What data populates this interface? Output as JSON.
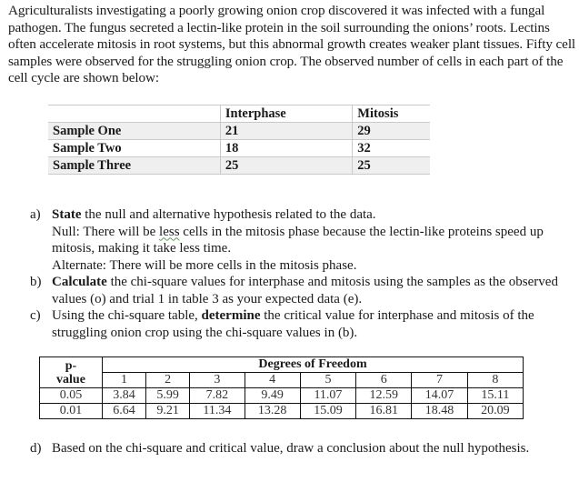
{
  "intro": {
    "paragraph": "Agriculturalists investigating a poorly growing onion crop discovered it was infected with a fungal pathogen. The fungus secreted a lectin-like protein in the soil surrounding the onions’ roots. Lectins often accelerate mitosis in root systems, but this abnormal growth creates weaker plant tissues. Fifty cell samples were observed for the struggling onion crop. The observed number of cells in each part of the cell cycle are shown below:"
  },
  "observation_table": {
    "headers": [
      "",
      "Interphase",
      "Mitosis"
    ],
    "rows": [
      {
        "label": "Sample One",
        "interphase": "21",
        "mitosis": "29"
      },
      {
        "label": "Sample Two",
        "interphase": "18",
        "mitosis": "32"
      },
      {
        "label": "Sample Three",
        "interphase": "25",
        "mitosis": "25"
      }
    ]
  },
  "questions": {
    "a": {
      "letter": "a)",
      "bold": "State",
      "text": " the null and alternative hypothesis related to the data.",
      "null_prefix": "Null: There will be ",
      "null_underlined": "less",
      "null_suffix": " cells in the mitosis phase because the lectin-like proteins speed up mitosis, making it take less time.",
      "alternate": "Alternate: There will be more cells in the mitosis phase."
    },
    "b": {
      "letter": "b)",
      "bold": "Calculate",
      "text": " the chi-square values for interphase and mitosis using the samples as the observed values (o) and trial 1 in table 3 as your expected data (e)."
    },
    "c": {
      "letter": "c)",
      "prefix": "Using the chi-square table, ",
      "bold": "determine",
      "text": " the critical value for interphase and mitosis of the struggling onion crop using the chi-square values in (b)."
    },
    "d": {
      "letter": "d)",
      "text": "Based on the chi-square and critical value, draw a conclusion about the null hypothesis."
    }
  },
  "chi_table": {
    "pvalue_header": "p-\nvalue",
    "pvalue_header_line1": "p-",
    "pvalue_header_line2": "value",
    "df_header": "Degrees of Freedom",
    "degrees": [
      "1",
      "2",
      "3",
      "4",
      "5",
      "6",
      "7",
      "8"
    ],
    "rows": [
      {
        "p": "0.05",
        "values": [
          "3.84",
          "5.99",
          "7.82",
          "9.49",
          "11.07",
          "12.59",
          "14.07",
          "15.11"
        ]
      },
      {
        "p": "0.01",
        "values": [
          "6.64",
          "9.21",
          "11.34",
          "13.28",
          "15.09",
          "16.81",
          "18.48",
          "20.09"
        ]
      }
    ]
  }
}
